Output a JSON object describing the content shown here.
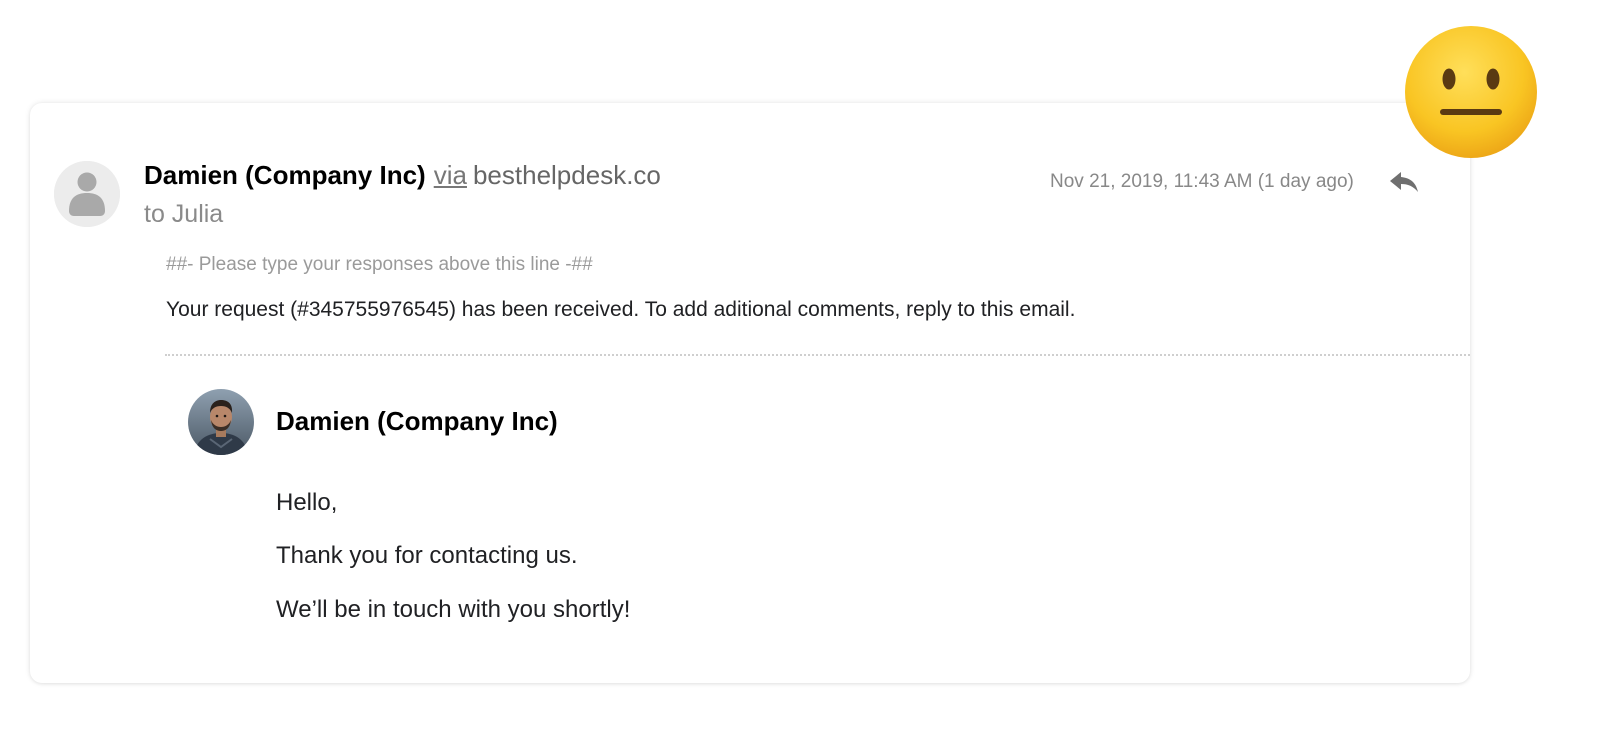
{
  "email": {
    "sender_name": "Damien (Company Inc)",
    "via_label": "via",
    "via_domain": "besthelpdesk.co",
    "recipient_line": "to Julia",
    "timestamp": "Nov 21, 2019, 11:43 AM (1 day ago)",
    "reply_icon": "reply-icon",
    "sender_avatar_icon": "person-placeholder-icon",
    "separator_note": "##- Please type your responses above this line -##",
    "request_text": "Your request (#345755976545) has been received. To add aditional comments, reply to this email."
  },
  "quoted_message": {
    "author_name": "Damien (Company Inc)",
    "avatar": "author-photo",
    "body": [
      "Hello,",
      "Thank you for contacting us.",
      "We’ll be in touch with you shortly!"
    ]
  },
  "decoration": {
    "emoji": "neutral-face-emoji"
  },
  "colors": {
    "primary_text": "#202124",
    "muted_text": "#888888",
    "divider": "#cfcfcf",
    "emoji_yellow": "#f7b91d"
  }
}
